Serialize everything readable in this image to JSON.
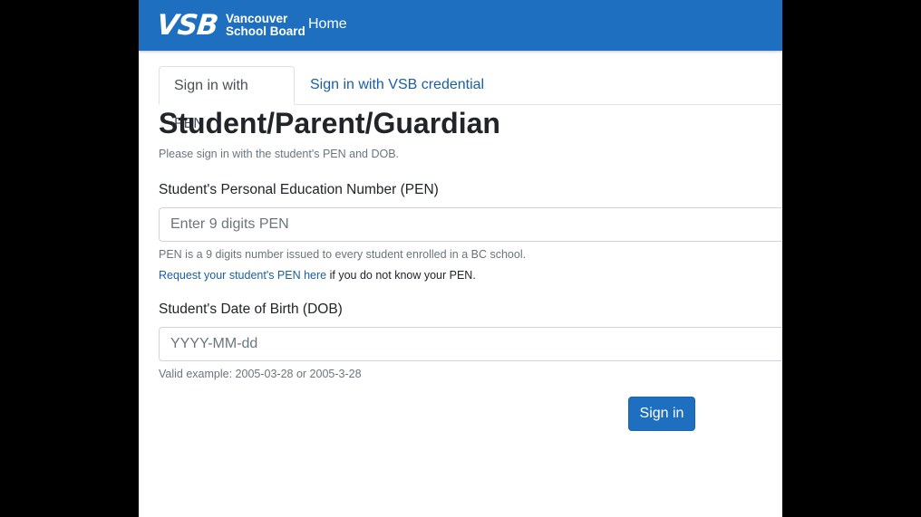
{
  "navbar": {
    "logo_mark": "VSB",
    "logo_line1": "Vancouver",
    "logo_line2": "School Board",
    "home_label": "Home"
  },
  "tabs": [
    {
      "label": "Sign in with PEN",
      "active": true
    },
    {
      "label": "Sign in with VSB credential",
      "active": false
    }
  ],
  "form": {
    "title": "Student/Parent/Guardian",
    "subtitle": "Please sign in with the student's PEN and DOB.",
    "pen": {
      "label": "Student's Personal Education Number (PEN)",
      "placeholder": "Enter 9 digits PEN",
      "value": "",
      "help": "PEN is a 9 digits number issued to every student enrolled in a BC school.",
      "request_link": "Request your student's PEN here",
      "request_suffix": " if you do not know your PEN."
    },
    "dob": {
      "label": "Student's Date of Birth (DOB)",
      "placeholder": "YYYY-MM-dd",
      "value": "",
      "help": "Valid example: 2005-03-28 or 2005-3-28"
    },
    "submit_label": "Sign in"
  },
  "colors": {
    "brand": "#1e6fc0",
    "link": "#1a5ea8",
    "page_background": "#000000"
  }
}
